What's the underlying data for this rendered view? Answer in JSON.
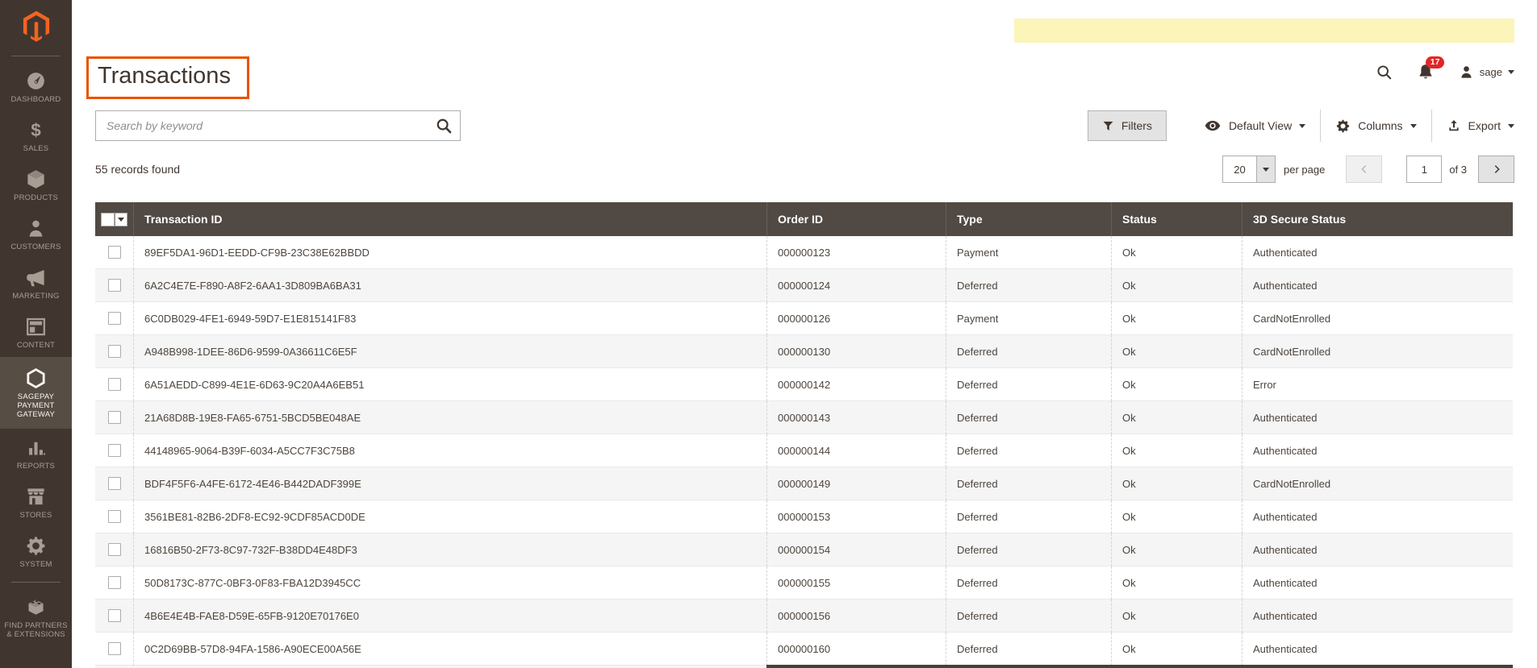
{
  "sidebar": {
    "items": [
      {
        "label": "DASHBOARD",
        "icon": "dashboard-icon",
        "active": false
      },
      {
        "label": "SALES",
        "icon": "sales-icon",
        "active": false
      },
      {
        "label": "PRODUCTS",
        "icon": "products-icon",
        "active": false
      },
      {
        "label": "CUSTOMERS",
        "icon": "customers-icon",
        "active": false
      },
      {
        "label": "MARKETING",
        "icon": "marketing-icon",
        "active": false
      },
      {
        "label": "CONTENT",
        "icon": "content-icon",
        "active": false
      },
      {
        "label": "SAGEPAY PAYMENT GATEWAY",
        "icon": "sagepay-icon",
        "active": true
      },
      {
        "label": "REPORTS",
        "icon": "reports-icon",
        "active": false
      },
      {
        "label": "STORES",
        "icon": "stores-icon",
        "active": false
      },
      {
        "label": "SYSTEM",
        "icon": "system-icon",
        "active": false
      },
      {
        "label": "FIND PARTNERS & EXTENSIONS",
        "icon": "find-partners-icon",
        "active": false,
        "divider_above": true
      }
    ]
  },
  "topbar": {
    "username": "sage",
    "notification_count": "17"
  },
  "page": {
    "title": "Transactions"
  },
  "toolbar": {
    "search_placeholder": "Search by keyword",
    "filters_label": "Filters",
    "view_label": "Default View",
    "columns_label": "Columns",
    "export_label": "Export"
  },
  "grid": {
    "records_text": "55 records found",
    "per_page_value": "20",
    "per_page_label": "per page",
    "current_page": "1",
    "total_pages_label": "of 3",
    "columns": [
      "Transaction ID",
      "Order ID",
      "Type",
      "Status",
      "3D Secure Status"
    ],
    "rows": [
      {
        "transaction_id": "89EF5DA1-96D1-EEDD-CF9B-23C38E62BBDD",
        "order_id": "000000123",
        "type": "Payment",
        "status": "Ok",
        "secure_status": "Authenticated"
      },
      {
        "transaction_id": "6A2C4E7E-F890-A8F2-6AA1-3D809BA6BA31",
        "order_id": "000000124",
        "type": "Deferred",
        "status": "Ok",
        "secure_status": "Authenticated"
      },
      {
        "transaction_id": "6C0DB029-4FE1-6949-59D7-E1E815141F83",
        "order_id": "000000126",
        "type": "Payment",
        "status": "Ok",
        "secure_status": "CardNotEnrolled"
      },
      {
        "transaction_id": "A948B998-1DEE-86D6-9599-0A36611C6E5F",
        "order_id": "000000130",
        "type": "Deferred",
        "status": "Ok",
        "secure_status": "CardNotEnrolled"
      },
      {
        "transaction_id": "6A51AEDD-C899-4E1E-6D63-9C20A4A6EB51",
        "order_id": "000000142",
        "type": "Deferred",
        "status": "Ok",
        "secure_status": "Error"
      },
      {
        "transaction_id": "21A68D8B-19E8-FA65-6751-5BCD5BE048AE",
        "order_id": "000000143",
        "type": "Deferred",
        "status": "Ok",
        "secure_status": "Authenticated"
      },
      {
        "transaction_id": "44148965-9064-B39F-6034-A5CC7F3C75B8",
        "order_id": "000000144",
        "type": "Deferred",
        "status": "Ok",
        "secure_status": "Authenticated"
      },
      {
        "transaction_id": "BDF4F5F6-A4FE-6172-4E46-B442DADF399E",
        "order_id": "000000149",
        "type": "Deferred",
        "status": "Ok",
        "secure_status": "CardNotEnrolled"
      },
      {
        "transaction_id": "3561BE81-82B6-2DF8-EC92-9CDF85ACD0DE",
        "order_id": "000000153",
        "type": "Deferred",
        "status": "Ok",
        "secure_status": "Authenticated"
      },
      {
        "transaction_id": "16816B50-2F73-8C97-732F-B38DD4E48DF3",
        "order_id": "000000154",
        "type": "Deferred",
        "status": "Ok",
        "secure_status": "Authenticated"
      },
      {
        "transaction_id": "50D8173C-877C-0BF3-0F83-FBA12D3945CC",
        "order_id": "000000155",
        "type": "Deferred",
        "status": "Ok",
        "secure_status": "Authenticated"
      },
      {
        "transaction_id": "4B6E4E4B-FAE8-D59E-65FB-9120E70176E0",
        "order_id": "000000156",
        "type": "Deferred",
        "status": "Ok",
        "secure_status": "Authenticated"
      },
      {
        "transaction_id": "0C2D69BB-57D8-94FA-1586-A90ECE00A56E",
        "order_id": "000000160",
        "type": "Deferred",
        "status": "Ok",
        "secure_status": "Authenticated"
      }
    ]
  },
  "colors": {
    "accent_orange": "#eb5202",
    "notice_yellow": "#fbf5ba",
    "badge_red": "#e22626",
    "grid_header_bg": "#514943",
    "sidebar_bg": "#41362f"
  }
}
